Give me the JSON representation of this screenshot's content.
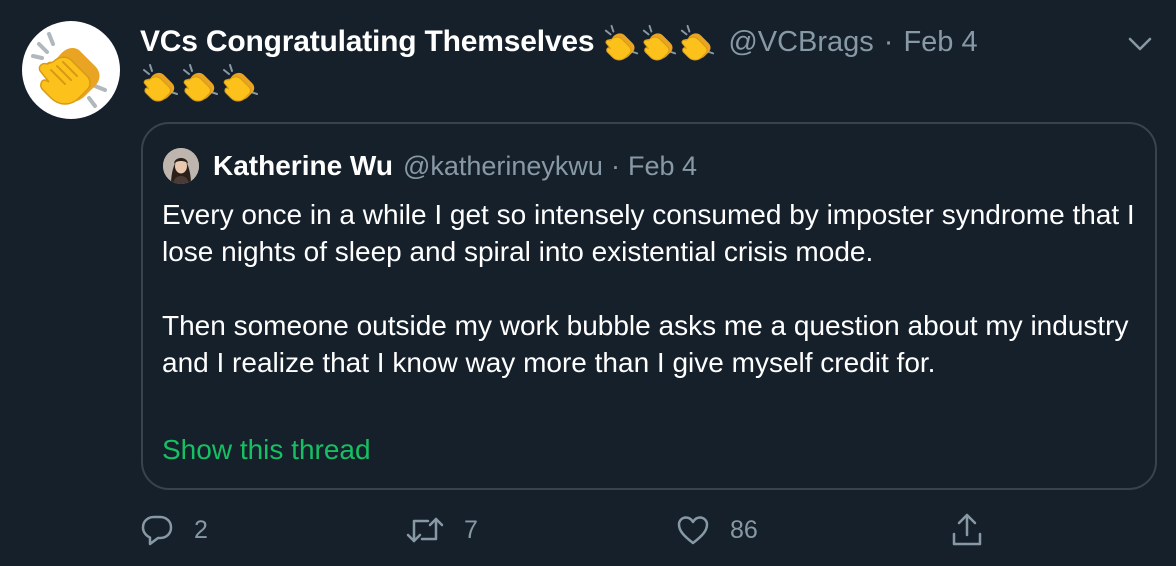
{
  "tweet": {
    "author": {
      "display_name": "VCs Congratulating Themselves",
      "name_emoji": [
        "clap-emoji",
        "clap-emoji",
        "clap-emoji"
      ],
      "handle": "@VCBrags",
      "separator": "·",
      "date": "Feb 4",
      "avatar_icon": "clapping-hands-icon"
    },
    "body_emoji": [
      "clap-emoji",
      "clap-emoji",
      "clap-emoji"
    ],
    "menu_icon": "chevron-down-icon",
    "quoted": {
      "display_name": "Katherine Wu",
      "handle": "@katherineykwu",
      "separator": "·",
      "date": "Feb 4",
      "paragraphs": [
        "Every once in a while I get so intensely consumed by imposter syndrome that I lose nights of sleep and spiral into existential crisis mode.",
        "Then someone outside my work bubble asks me a question about my industry and I realize that I know way more than I give myself credit for."
      ],
      "show_thread": "Show this thread"
    },
    "actions": {
      "reply": {
        "icon": "reply-icon",
        "count": "2"
      },
      "retweet": {
        "icon": "retweet-icon",
        "count": "7"
      },
      "like": {
        "icon": "heart-icon",
        "count": "86"
      },
      "share": {
        "icon": "share-icon"
      }
    }
  },
  "colors": {
    "background": "#15202b",
    "text_primary": "#ffffff",
    "text_secondary": "#8899a6",
    "border": "#38444d",
    "accent_green": "#17bf63",
    "avatar_bg": "#ffffff"
  }
}
